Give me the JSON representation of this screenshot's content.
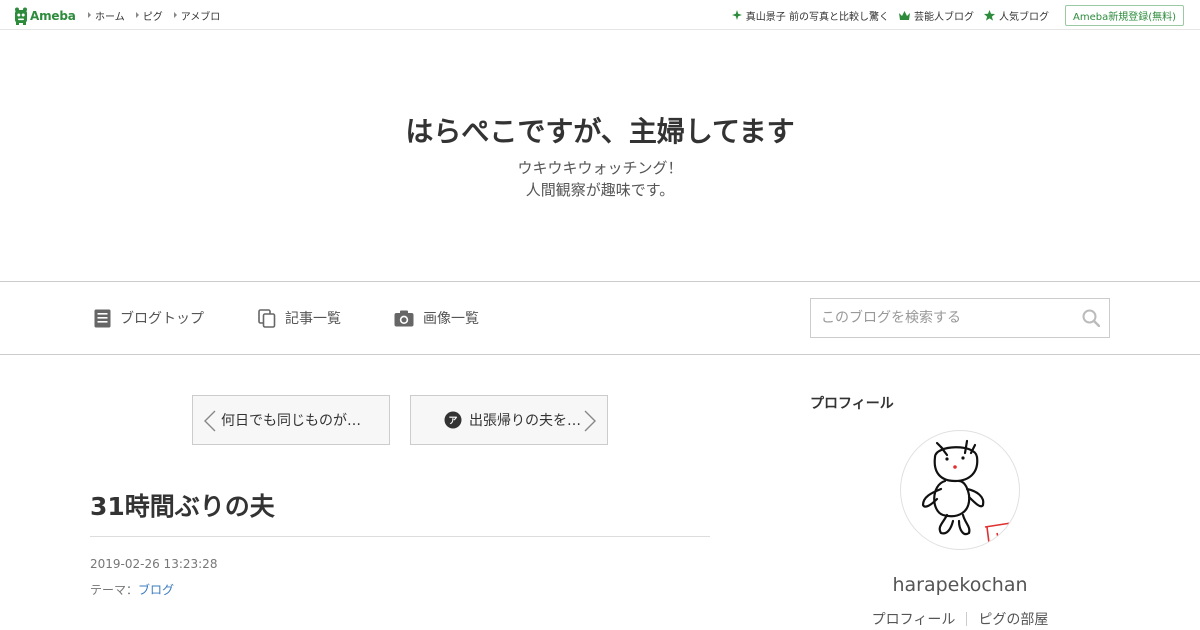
{
  "topbar": {
    "logo_text": "Ameba",
    "nav": [
      {
        "label": "ホーム"
      },
      {
        "label": "ピグ"
      },
      {
        "label": "アメブロ"
      }
    ],
    "right": [
      {
        "label": "真山景子 前の写真と比較し驚く",
        "icon": "sparkle-icon"
      },
      {
        "label": "芸能人ブログ",
        "icon": "crown-icon"
      },
      {
        "label": "人気ブログ",
        "icon": "star-icon"
      }
    ],
    "register_label": "Ameba新規登録(無料)"
  },
  "header": {
    "title": "はらぺこですが、主婦してます",
    "desc_line1": "ウキウキウォッチング！",
    "desc_line2": "人間観察が趣味です。"
  },
  "nav": {
    "items": [
      {
        "label": "ブログトップ",
        "icon": "document-icon"
      },
      {
        "label": "記事一覧",
        "icon": "copy-icon"
      },
      {
        "label": "画像一覧",
        "icon": "camera-icon"
      }
    ],
    "search_placeholder": "このブログを検索する"
  },
  "pager": {
    "prev_label": "何日でも同じものが…",
    "next_label": "出張帰りの夫を…"
  },
  "article": {
    "title": "31時間ぶりの夫",
    "date": "2019-02-26 13:23:28",
    "theme_label": "テーマ：",
    "theme_value": "ブログ"
  },
  "sidebar": {
    "heading": "プロフィール",
    "name": "harapekochan",
    "links": [
      {
        "label": "プロフィール"
      },
      {
        "label": "ピグの部屋"
      }
    ]
  },
  "colors": {
    "brand_green": "#2d8c3c",
    "link_blue": "#3b7bbf"
  }
}
